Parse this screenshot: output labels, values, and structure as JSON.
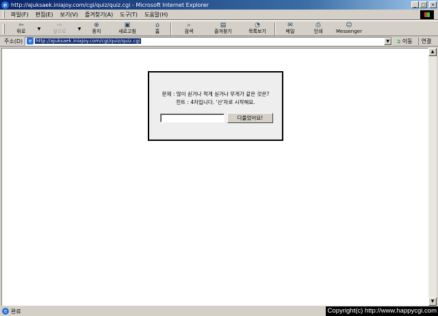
{
  "window": {
    "title": "http://ajuksaek.iniajoy.com/cgi/quiz/quiz.cgi - Microsoft Internet Explorer",
    "minimize": "_",
    "maximize": "□",
    "close": "×"
  },
  "menu": {
    "items": [
      "파일(F)",
      "편집(E)",
      "보기(V)",
      "즐겨찾기(A)",
      "도구(T)",
      "도움말(H)"
    ]
  },
  "toolbar": {
    "back": "뒤로",
    "forward": "앞으로",
    "stop": "중지",
    "refresh": "새로고침",
    "home": "홈",
    "search": "검색",
    "favorites": "즐겨찾기",
    "history": "목록보기",
    "mail": "메일",
    "print": "인쇄",
    "messenger": "Messenger"
  },
  "address": {
    "label": "주소(D)",
    "url": "http://ajuksaek.iniajoy.com/cgi/quiz/quiz.cgi",
    "go": "이동",
    "links": "연결"
  },
  "quiz": {
    "question": "문제 : 많이 싣거나 적게 싣거나 무게가 같은 것은?",
    "hint": "힌트 : 4자입니다. '산'자로 시작해요.",
    "answer_value": "",
    "submit_label": "다풀었어요!"
  },
  "status": {
    "text": "완료",
    "copyright": "Copyright(c) http://www.happycgi.com"
  }
}
